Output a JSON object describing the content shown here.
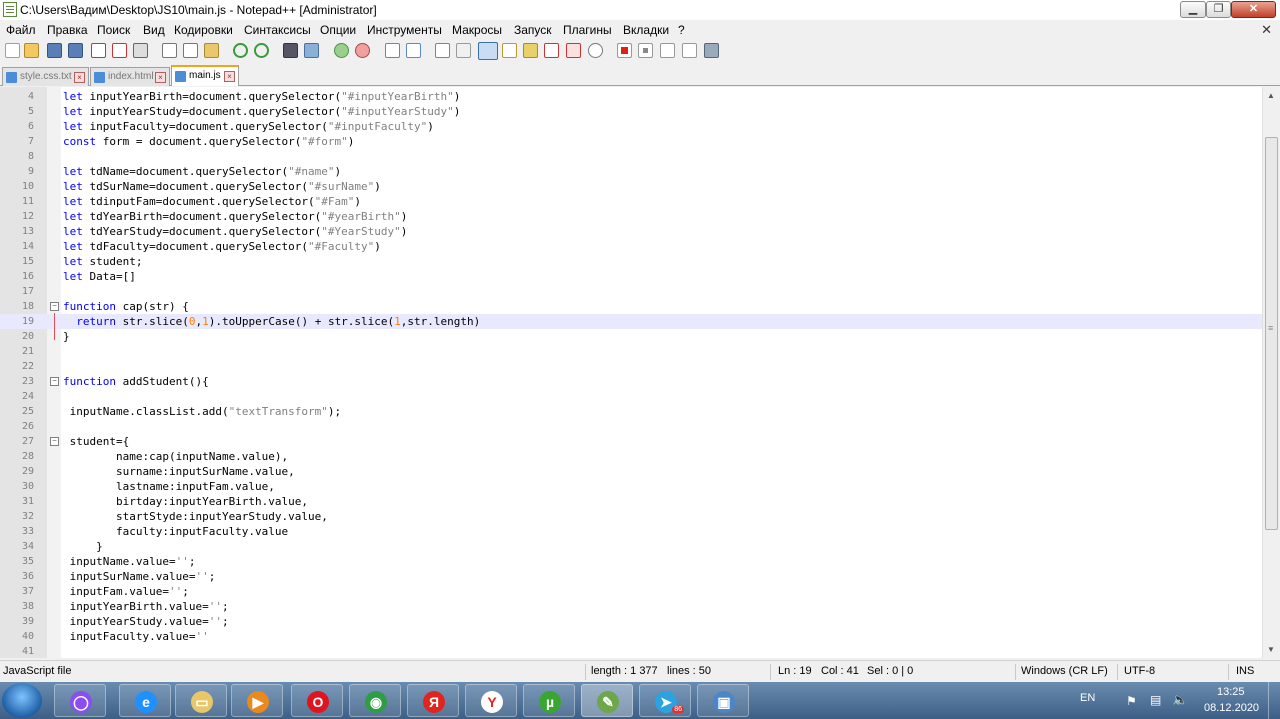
{
  "window": {
    "title": "C:\\Users\\Вадим\\Desktop\\JS10\\main.js - Notepad++ [Administrator]",
    "controls": {
      "minimize": "▁",
      "maximize": "❐",
      "close": "✕"
    }
  },
  "menu": {
    "items": [
      "Файл",
      "Правка",
      "Поиск",
      "Вид",
      "Кодировки",
      "Синтаксисы",
      "Опции",
      "Инструменты",
      "Макросы",
      "Запуск",
      "Плагины",
      "Вкладки",
      "?"
    ],
    "close": "✕"
  },
  "tabs": [
    {
      "label": "style.css.txt",
      "active": false
    },
    {
      "label": "index.html",
      "active": false
    },
    {
      "label": "main.js",
      "active": true
    }
  ],
  "editor": {
    "current_line": 19,
    "lines": [
      {
        "n": "4",
        "text": "let inputYearBirth=document.querySelector(\"#inputYearBirth\")"
      },
      {
        "n": "5",
        "text": "let inputYearStudy=document.querySelector(\"#inputYearStudy\")"
      },
      {
        "n": "6",
        "text": "let inputFaculty=document.querySelector(\"#inputFaculty\")"
      },
      {
        "n": "7",
        "text": "const form = document.querySelector(\"#form\")"
      },
      {
        "n": "8",
        "text": ""
      },
      {
        "n": "9",
        "text": "let tdName=document.querySelector(\"#name\")"
      },
      {
        "n": "10",
        "text": "let tdSurName=document.querySelector(\"#surName\")"
      },
      {
        "n": "11",
        "text": "let tdinputFam=document.querySelector(\"#Fam\")"
      },
      {
        "n": "12",
        "text": "let tdYearBirth=document.querySelector(\"#yearBirth\")"
      },
      {
        "n": "13",
        "text": "let tdYearStudy=document.querySelector(\"#YearStudy\")"
      },
      {
        "n": "14",
        "text": "let tdFaculty=document.querySelector(\"#Faculty\")"
      },
      {
        "n": "15",
        "text": "let student;"
      },
      {
        "n": "16",
        "text": "let Data=[]"
      },
      {
        "n": "17",
        "text": ""
      },
      {
        "n": "18",
        "text": "function cap(str) {"
      },
      {
        "n": "19",
        "text": "  return str.slice(0,1).toUpperCase() + str.slice(1,str.length)"
      },
      {
        "n": "20",
        "text": "}"
      },
      {
        "n": "21",
        "text": ""
      },
      {
        "n": "22",
        "text": ""
      },
      {
        "n": "23",
        "text": "function addStudent(){"
      },
      {
        "n": "24",
        "text": ""
      },
      {
        "n": "25",
        "text": " inputName.classList.add(\"textTransform\");"
      },
      {
        "n": "26",
        "text": ""
      },
      {
        "n": "27",
        "text": " student={"
      },
      {
        "n": "28",
        "text": "        name:cap(inputName.value),"
      },
      {
        "n": "29",
        "text": "        surname:inputSurName.value,"
      },
      {
        "n": "30",
        "text": "        lastname:inputFam.value,"
      },
      {
        "n": "31",
        "text": "        birtday:inputYearBirth.value,"
      },
      {
        "n": "32",
        "text": "        startStyde:inputYearStudy.value,"
      },
      {
        "n": "33",
        "text": "        faculty:inputFaculty.value"
      },
      {
        "n": "34",
        "text": "     }"
      },
      {
        "n": "35",
        "text": " inputName.value='';"
      },
      {
        "n": "36",
        "text": " inputSurName.value='';"
      },
      {
        "n": "37",
        "text": " inputFam.value='';"
      },
      {
        "n": "38",
        "text": " inputYearBirth.value='';"
      },
      {
        "n": "39",
        "text": " inputYearStudy.value='';"
      },
      {
        "n": "40",
        "text": " inputFaculty.value=''"
      },
      {
        "n": "41",
        "text": ""
      }
    ]
  },
  "status": {
    "file_type": "JavaScript file",
    "length": "length : 1 377",
    "lines": "lines : 50",
    "ln": "Ln : 19",
    "col": "Col : 41",
    "sel": "Sel : 0 | 0",
    "eol": "Windows (CR LF)",
    "encoding": "UTF-8",
    "mode": "INS"
  },
  "taskbar": {
    "apps": [
      {
        "icon": "alice-icon",
        "glyph": "◯",
        "color": "#8a4df0"
      },
      {
        "icon": "internet-explorer-icon",
        "glyph": "e",
        "color": "#1e90ff"
      },
      {
        "icon": "file-explorer-icon",
        "glyph": "▭",
        "color": "#e8c66a"
      },
      {
        "icon": "media-player-icon",
        "glyph": "▶",
        "color": "#e88a1e"
      },
      {
        "icon": "opera-icon",
        "glyph": "O",
        "color": "#e0141e"
      },
      {
        "icon": "chrome-icon",
        "glyph": "◉",
        "color": "#2e9e44"
      },
      {
        "icon": "yandex-icon",
        "glyph": "Я",
        "color": "#e0241e"
      },
      {
        "icon": "yandex-browser-icon",
        "glyph": "Y",
        "color": "#ffffff"
      },
      {
        "icon": "utorrent-icon",
        "glyph": "µ",
        "color": "#3aa632"
      },
      {
        "icon": "notepad-plus-plus-icon",
        "glyph": "✎",
        "color": "#6ea64a"
      },
      {
        "icon": "telegram-icon",
        "glyph": "➤",
        "color": "#2aa3e0"
      },
      {
        "icon": "remote-desktop-icon",
        "glyph": "▣",
        "color": "#4a86c8"
      }
    ],
    "telegram_badge": "86",
    "language": "EN",
    "time": "13:25",
    "date": "08.12.2020"
  }
}
